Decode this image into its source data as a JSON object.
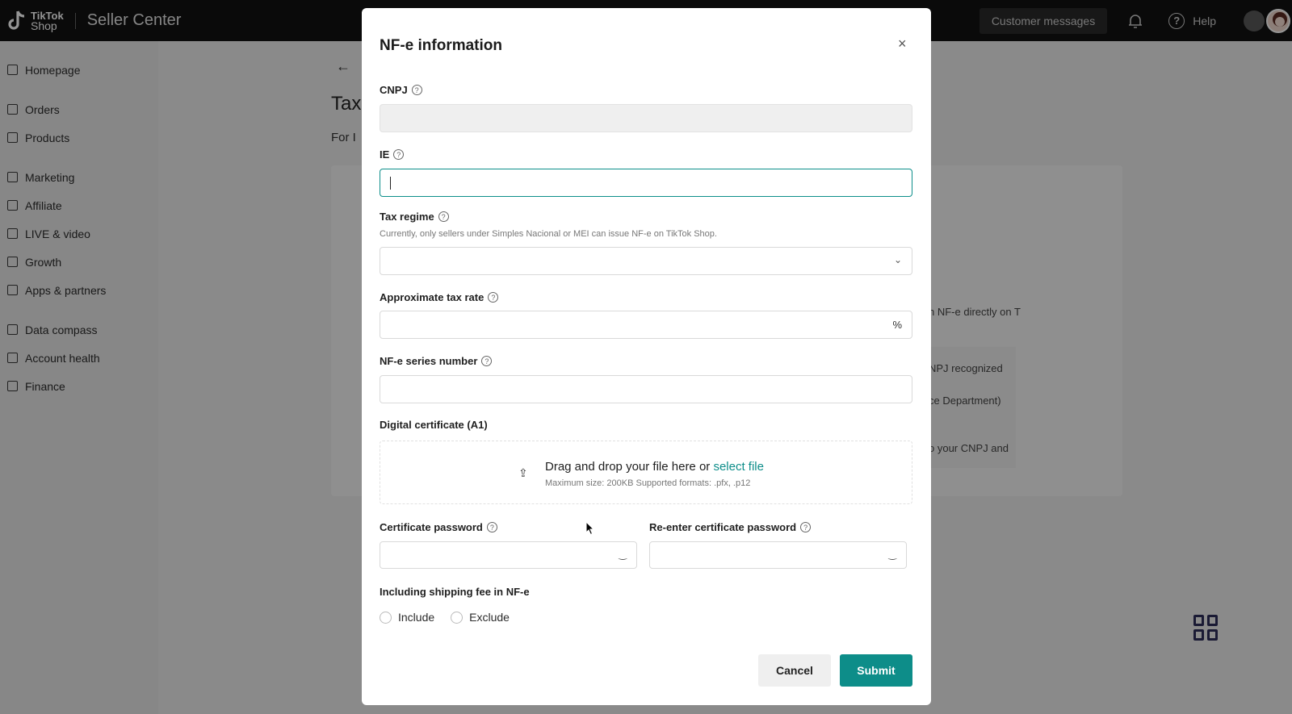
{
  "topbar": {
    "logo_line1": "TikTok",
    "logo_line2": "Shop",
    "app_title": "Seller Center",
    "customer_messages": "Customer messages",
    "help": "Help"
  },
  "sidebar": {
    "items": [
      {
        "label": "Homepage",
        "icon": "home-icon"
      },
      {
        "label": "Orders",
        "icon": "orders-icon"
      },
      {
        "label": "Products",
        "icon": "products-icon"
      },
      {
        "label": "Marketing",
        "icon": "marketing-icon"
      },
      {
        "label": "Affiliate",
        "icon": "affiliate-icon"
      },
      {
        "label": "LIVE & video",
        "icon": "video-icon"
      },
      {
        "label": "Growth",
        "icon": "growth-icon"
      },
      {
        "label": "Apps & partners",
        "icon": "apps-icon"
      },
      {
        "label": "Data compass",
        "icon": "data-icon"
      },
      {
        "label": "Account health",
        "icon": "health-icon"
      },
      {
        "label": "Finance",
        "icon": "finance-icon"
      }
    ]
  },
  "background": {
    "title_partial": "Tax",
    "subtitle_partial": "For I",
    "text1": "n NF-e directly on T",
    "text2": "NPJ recognized",
    "text3": "ce Department)",
    "text4": "o your CNPJ and"
  },
  "modal": {
    "title": "NF-e information",
    "close": "×",
    "cnpj_label": "CNPJ",
    "ie_label": "IE",
    "tax_regime_label": "Tax regime",
    "tax_regime_hint": "Currently, only sellers under Simples Nacional or MEI can issue NF-e on TikTok Shop.",
    "tax_rate_label": "Approximate tax rate",
    "tax_rate_suffix": "%",
    "series_label": "NF-e series number",
    "cert_label": "Digital certificate (A1)",
    "upload_text": "Drag and drop your file here or ",
    "upload_link": "select file",
    "upload_sub": "Maximum size: 200KB Supported formats: .pfx, .p12",
    "pw_label": "Certificate password",
    "pw2_label": "Re-enter certificate password",
    "shipping_label": "Including shipping fee in NF-e",
    "include": "Include",
    "exclude": "Exclude",
    "cancel": "Cancel",
    "submit": "Submit"
  },
  "colors": {
    "accent": "#0d8d89",
    "topbar": "#121212"
  }
}
